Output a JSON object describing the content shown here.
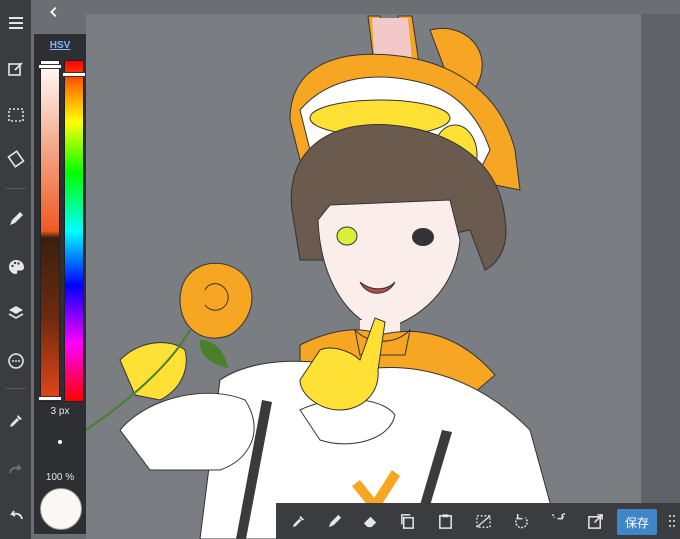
{
  "color_panel": {
    "mode_label": "HSV",
    "brush_size": "3 px",
    "opacity": "100 %",
    "current_color": "#fbf7f5",
    "sv_level": 0.02,
    "hue_level": 0.04
  },
  "bottom_bar": {
    "save_label": "保存"
  },
  "icons": {
    "left_toolbar": [
      "menu-icon",
      "edit-icon",
      "selection-icon",
      "transform-icon",
      "brush-icon",
      "palette-icon",
      "layers-icon",
      "more-circle-icon",
      "eyedropper-icon",
      "redo-icon",
      "undo-icon"
    ],
    "bottom_toolbar": [
      "eyedropper-icon",
      "pen-icon",
      "eraser-icon",
      "copy-icon",
      "paste-icon",
      "deselect-icon",
      "rotate-left-icon",
      "rotate-right-icon",
      "export-icon",
      "grip-icon"
    ]
  },
  "colors": {
    "accent": "#3f86c8",
    "toolbar": "#3a3c40",
    "canvas_bg": "#7a7d81"
  }
}
